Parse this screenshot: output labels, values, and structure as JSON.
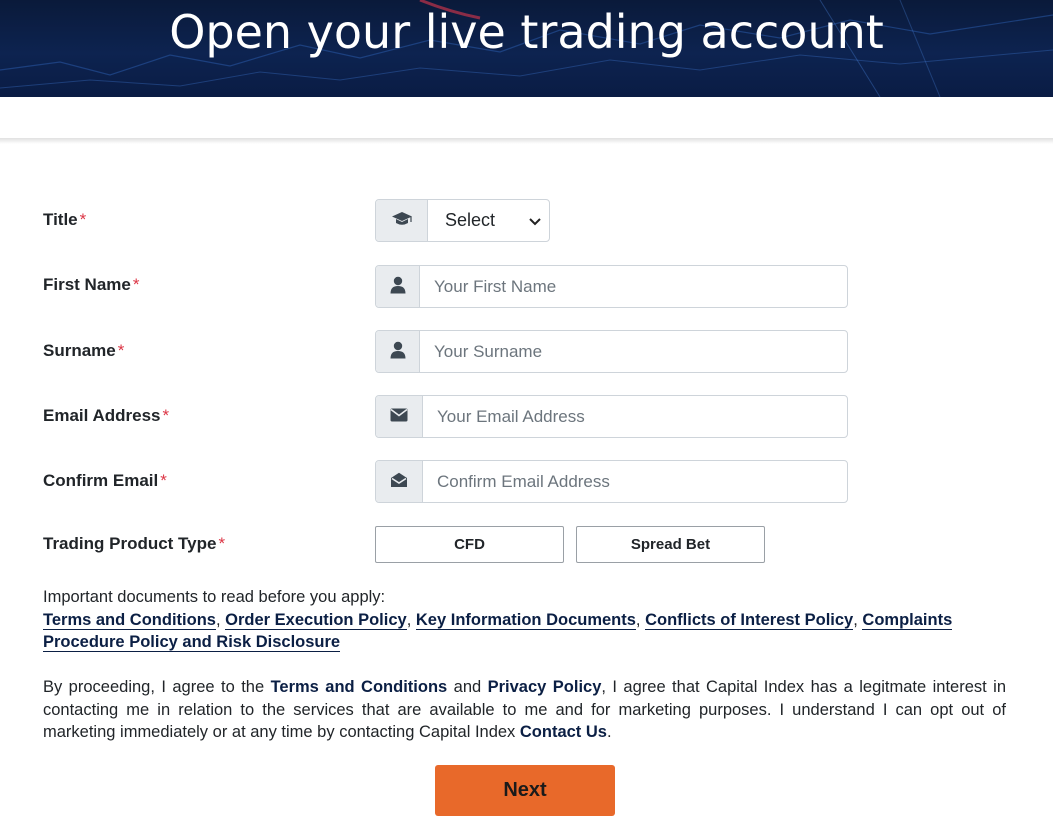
{
  "hero": {
    "title": "Open your live trading account"
  },
  "form": {
    "title_row": {
      "label": "Title",
      "required_mark": "*",
      "icon": "graduation-cap-icon",
      "selected": "Select"
    },
    "first_name_row": {
      "label": "First Name",
      "required_mark": "*",
      "icon": "user-icon",
      "placeholder": "Your First Name"
    },
    "surname_row": {
      "label": "Surname",
      "required_mark": "*",
      "icon": "user-icon",
      "placeholder": "Your Surname"
    },
    "email_row": {
      "label": "Email Address",
      "required_mark": "*",
      "icon": "envelope-icon",
      "placeholder": "Your Email Address"
    },
    "confirm_email_row": {
      "label": "Confirm Email",
      "required_mark": "*",
      "icon": "envelope-open-icon",
      "placeholder": "Confirm Email Address"
    },
    "product_row": {
      "label": "Trading Product Type",
      "required_mark": "*",
      "options": [
        "CFD",
        "Spread Bet"
      ]
    }
  },
  "documents": {
    "intro": "Important documents to read before you apply:",
    "links": [
      "Terms and Conditions",
      "Order Execution Policy",
      "Key Information Documents",
      "Conflicts of Interest Policy",
      "Complaints Procedure Policy and Risk Disclosure"
    ],
    "separator": ","
  },
  "consent": {
    "part1": "By proceeding, I agree to the ",
    "link_terms": "Terms and Conditions",
    "part2": " and ",
    "link_privacy": "Privacy Policy",
    "part3": ", I agree that Capital Index has a legitmate interest in contacting me in relation to the services that are available to me and for marketing purposes. I understand I can opt out of marketing immediately or at any time by contacting Capital Index ",
    "link_contact": "Contact Us",
    "part4": "."
  },
  "actions": {
    "next_label": "Next"
  },
  "colors": {
    "hero_bg": "#0d2350",
    "accent": "#e8692a",
    "required": "#dc3545",
    "link": "#0b1f44"
  }
}
